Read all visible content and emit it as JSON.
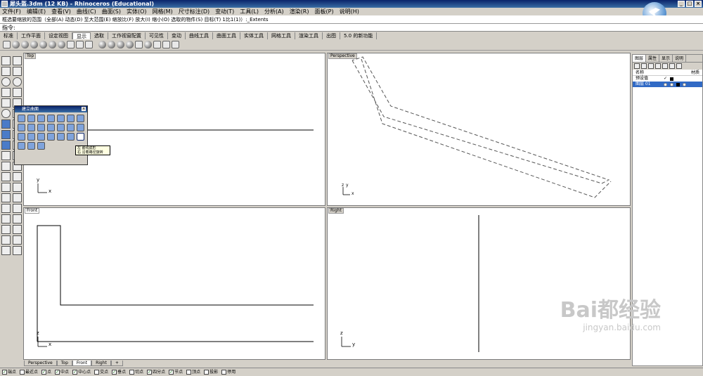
{
  "window": {
    "title": "犀头盔.3dm (12 KB) - Rhinoceros (Educational)",
    "buttons": [
      "_",
      "□",
      "×"
    ]
  },
  "menu": [
    "文件(F)",
    "编辑(E)",
    "查看(V)",
    "曲线(C)",
    "曲面(S)",
    "实体(O)",
    "网格(M)",
    "尺寸标注(D)",
    "变动(T)",
    "工具(L)",
    "分析(A)",
    "渲染(R)",
    "面板(P)",
    "说明(H)"
  ],
  "history_text": "框选要缩放的范围（全部(A) 动态(D) 至大范围(E) 缩放比(F) 放大(I) 缩小(O) 选取的物件(S) 目标(T) 1比1(1)）:_Extents",
  "command_prompt": "指令:",
  "tabs": {
    "items": [
      "标准",
      "工作平面",
      "设定视图",
      "显示",
      "选取",
      "工作视窗配置",
      "可见性",
      "变动",
      "曲线工具",
      "曲面工具",
      "实体工具",
      "网格工具",
      "渲染工具",
      "出图",
      "5.0 的新功能"
    ],
    "active_index": 3
  },
  "viewports": {
    "top": {
      "label": "Top",
      "axis_x": "x",
      "axis_y": "y"
    },
    "perspective": {
      "label": "Perspective",
      "axis_x": "x",
      "axis_y": "y",
      "axis_z": "z"
    },
    "front": {
      "label": "Front",
      "axis_x": "x",
      "axis_y": "z"
    },
    "right": {
      "label": "Right",
      "axis_x": "y",
      "axis_y": "z"
    }
  },
  "viewport_tabs": [
    "Perspective",
    "Top",
    "Front",
    "Right",
    "+"
  ],
  "popup": {
    "title": "建立曲面",
    "tooltip_line1": "左 嵌线成形",
    "tooltip_line2": "右 沿着路径旋转"
  },
  "panel": {
    "tabs": [
      "图层",
      "属性",
      "显示",
      "说明"
    ],
    "header_name": "名称",
    "header_material": "材质",
    "layers": [
      {
        "name": "预设值",
        "check": "✓"
      },
      {
        "name": "图层 01",
        "check": ""
      }
    ]
  },
  "statusbar": [
    {
      "label": "端点",
      "checked": true
    },
    {
      "label": "最近点",
      "checked": false
    },
    {
      "label": "点",
      "checked": true
    },
    {
      "label": "中点",
      "checked": true
    },
    {
      "label": "中心点",
      "checked": true
    },
    {
      "label": "交点",
      "checked": false
    },
    {
      "label": "垂点",
      "checked": true
    },
    {
      "label": "切点",
      "checked": false
    },
    {
      "label": "四分点",
      "checked": true
    },
    {
      "label": "节点",
      "checked": true
    },
    {
      "label": "顶点",
      "checked": false
    },
    {
      "label": "投影",
      "checked": false
    },
    {
      "label": "停用",
      "checked": false
    }
  ],
  "watermark": {
    "logo": "Bai都经验",
    "url": "jingyan.baidu.com"
  }
}
